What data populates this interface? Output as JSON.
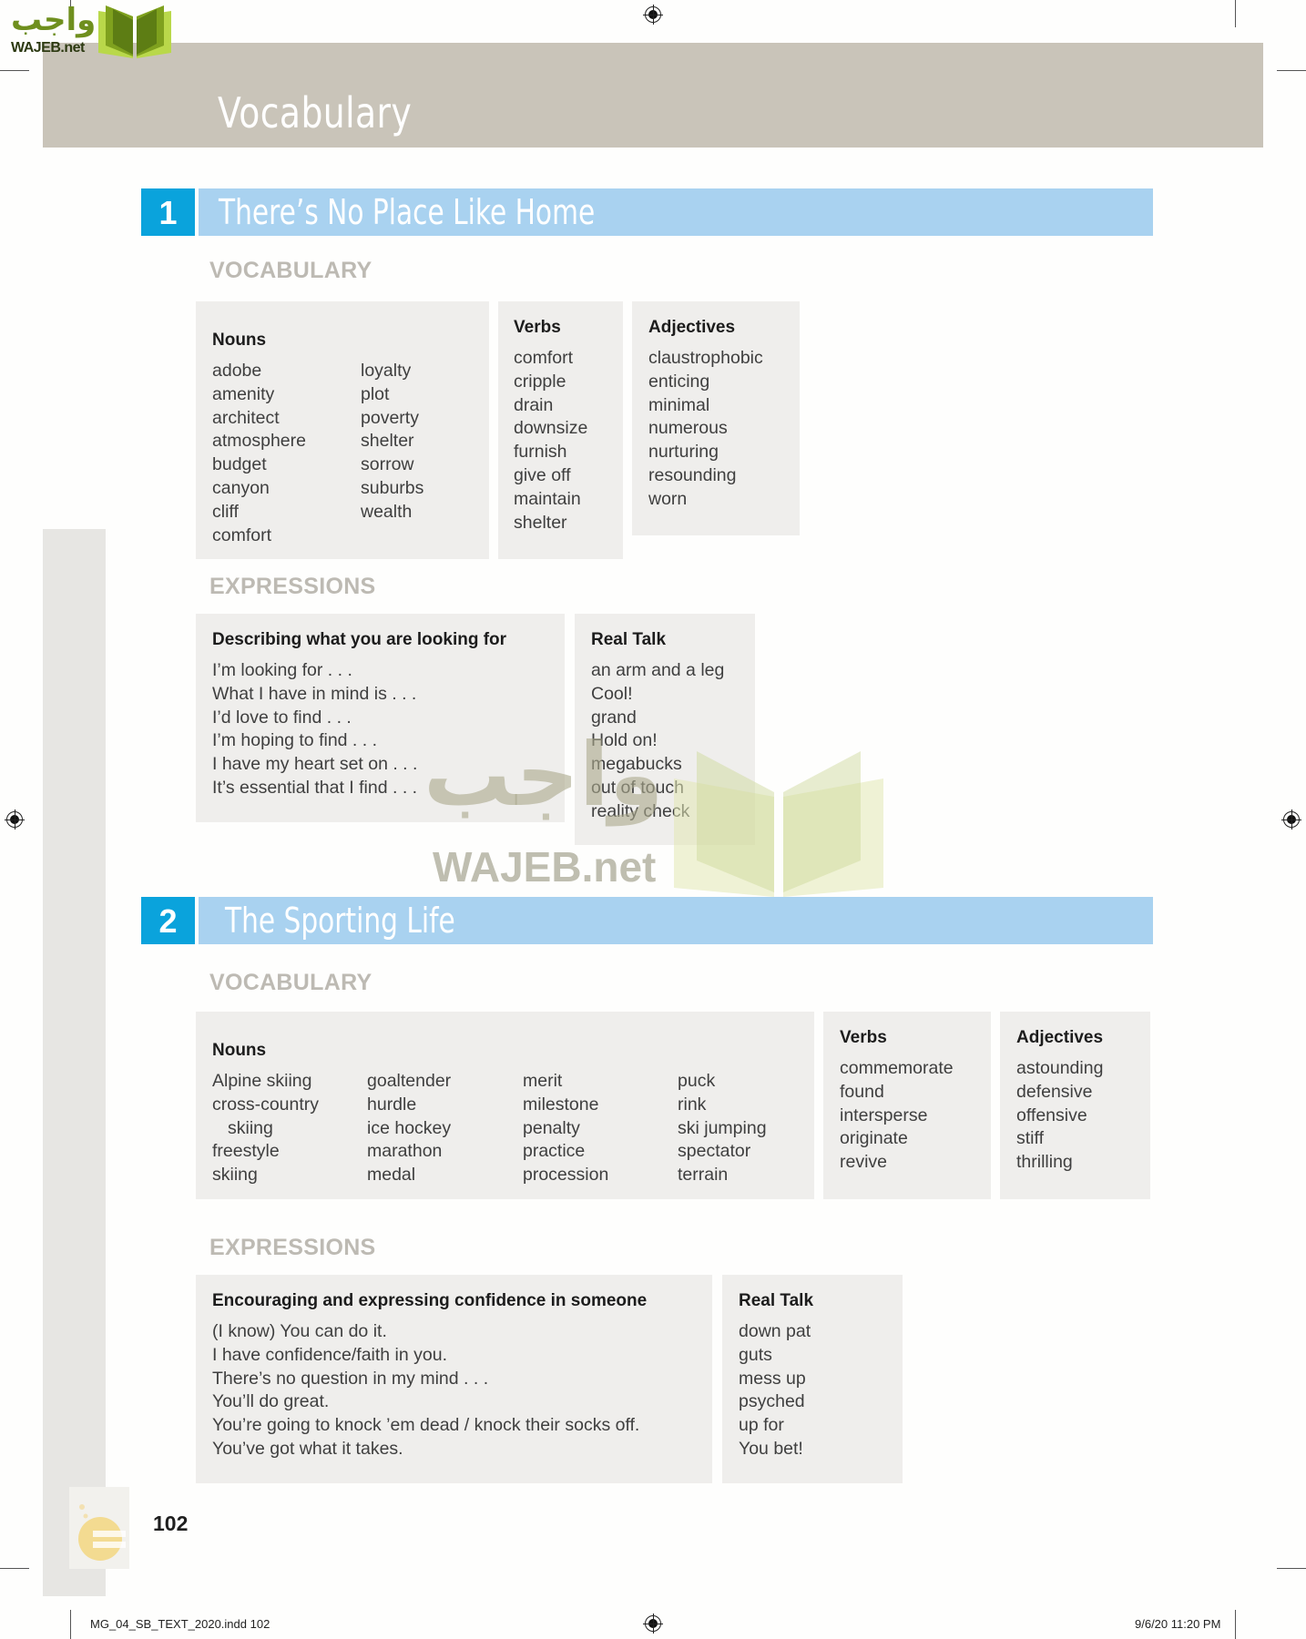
{
  "header": {
    "logo_arabic": "واجب",
    "logo_latin": "WAJEB.net",
    "page_title": "Vocabulary"
  },
  "units": [
    {
      "number": "1",
      "title": "There’s No Place Like Home",
      "vocabulary_label": "VOCABULARY",
      "nouns": {
        "title": "Nouns",
        "col1": [
          "adobe",
          "amenity",
          "architect",
          "atmosphere",
          "budget",
          "canyon",
          "cliff",
          "comfort"
        ],
        "col2": [
          "loyalty",
          "plot",
          "poverty",
          "shelter",
          "sorrow",
          "suburbs",
          "wealth"
        ]
      },
      "verbs": {
        "title": "Verbs",
        "items": [
          "comfort",
          "cripple",
          "drain",
          "downsize",
          "furnish",
          "give off",
          "maintain",
          "shelter"
        ]
      },
      "adjectives": {
        "title": "Adjectives",
        "items": [
          "claustrophobic",
          "enticing",
          "minimal",
          "numerous",
          "nurturing",
          "resounding",
          "worn"
        ]
      },
      "expressions_label": "EXPRESSIONS",
      "expressions": {
        "title": "Describing what you are looking for",
        "items": [
          "I’m looking for . . .",
          "What I have in mind is . . .",
          "I’d love to find . . .",
          "I’m hoping to find . . .",
          "I have my heart set on . . .",
          "It’s essential that I find . . ."
        ]
      },
      "real_talk": {
        "title": "Real Talk",
        "items": [
          "an arm and a leg",
          "Cool!",
          "grand",
          "Hold on!",
          "megabucks",
          "out of touch",
          "reality check"
        ]
      }
    },
    {
      "number": "2",
      "title": "The Sporting Life",
      "vocabulary_label": "VOCABULARY",
      "nouns": {
        "title": "Nouns",
        "col1": [
          "Alpine skiing",
          "cross-country",
          "skiing",
          "freestyle",
          "skiing"
        ],
        "col2": [
          "goaltender",
          "hurdle",
          "ice hockey",
          "marathon",
          "medal"
        ],
        "col3": [
          "merit",
          "milestone",
          "penalty",
          "practice",
          "procession"
        ],
        "col4": [
          "puck",
          "rink",
          "ski jumping",
          "spectator",
          "terrain"
        ]
      },
      "verbs": {
        "title": "Verbs",
        "items": [
          "commemorate",
          "found",
          "intersperse",
          "originate",
          "revive"
        ]
      },
      "adjectives": {
        "title": "Adjectives",
        "items": [
          "astounding",
          "defensive",
          "offensive",
          "stiff",
          "thrilling"
        ]
      },
      "expressions_label": "EXPRESSIONS",
      "expressions": {
        "title": "Encouraging and expressing confidence in someone",
        "items": [
          "(I know) You can do it.",
          "I have confidence/faith in you.",
          "There’s no question in my mind . . .",
          "You’ll do great.",
          "You’re going to knock ’em dead / knock their socks off.",
          "You’ve got what it takes."
        ]
      },
      "real_talk": {
        "title": "Real Talk",
        "items": [
          "down pat",
          "guts",
          "mess up",
          "psyched",
          "up for",
          "You bet!"
        ]
      }
    }
  ],
  "footer": {
    "page_number": "102",
    "slug_file": "MG_04_SB_TEXT_2020.indd   102",
    "slug_date": "9/6/20   11:20 PM"
  },
  "watermark": {
    "arabic": "واجب",
    "latin": "WAJEB.net"
  },
  "colors": {
    "banner": "#c9c4b9",
    "unit_number_bg": "#0aa3dc",
    "unit_bar_bg": "#a9d2f0",
    "box_bg": "#efeeec",
    "section_label": "#bdbab3"
  }
}
